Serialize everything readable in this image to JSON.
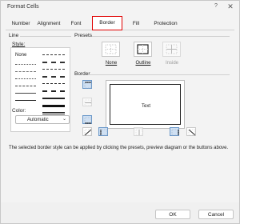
{
  "window": {
    "title": "Format Cells",
    "help": "?",
    "close": "✕"
  },
  "tabs": [
    "Number",
    "Alignment",
    "Font",
    "Border",
    "Fill",
    "Protection"
  ],
  "active_tab": "Border",
  "line": {
    "group_label": "Line",
    "style_label": "Style:",
    "none_label": "None",
    "color_label": "Color:",
    "color_value": "Automatic"
  },
  "presets": {
    "group_label": "Presets",
    "items": [
      {
        "label": "None",
        "icon": "border-none-icon"
      },
      {
        "label": "Outline",
        "icon": "border-outline-icon"
      },
      {
        "label": "Inside",
        "icon": "border-inside-icon"
      }
    ]
  },
  "border": {
    "group_label": "Border",
    "preview_text": "Text"
  },
  "hint": "The selected border style can be applied by clicking the presets, preview diagram or the buttons above.",
  "footer": {
    "ok": "OK",
    "cancel": "Cancel"
  },
  "colors": {
    "accent_selection": "#cfe0f3",
    "tab_highlight": "#e00000"
  }
}
